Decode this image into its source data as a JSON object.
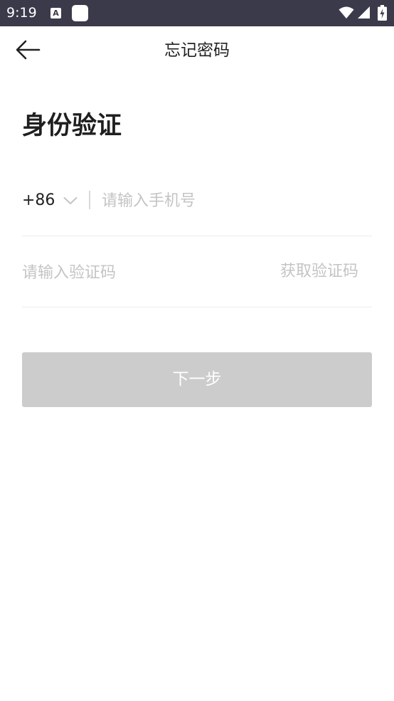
{
  "status_bar": {
    "time": "9:19",
    "a_icon_letter": "A",
    "icons": [
      "a-notification-icon",
      "square-notification-icon",
      "wifi-icon",
      "signal-icon",
      "battery-icon"
    ]
  },
  "app_bar": {
    "title": "忘记密码",
    "back_icon": "arrow-left-icon"
  },
  "main": {
    "heading": "身份验证",
    "phone": {
      "country_code": "+86",
      "placeholder": "请输入手机号",
      "value": ""
    },
    "code": {
      "placeholder": "请输入验证码",
      "value": "",
      "get_code_label": "获取验证码"
    },
    "next_button_label": "下一步"
  },
  "colors": {
    "status_bar_bg": "#3b3a4a",
    "button_disabled_bg": "#cccccc",
    "placeholder_text": "#c4c4c4",
    "title_text": "#222222"
  }
}
